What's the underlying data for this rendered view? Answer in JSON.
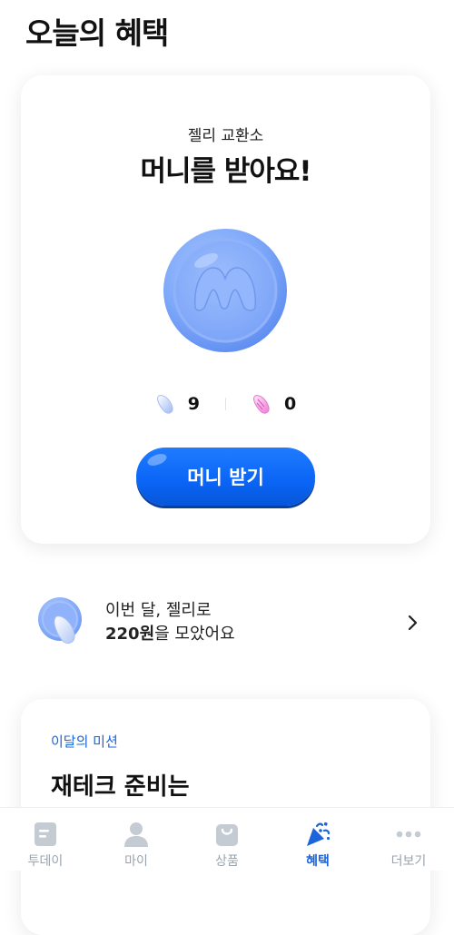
{
  "page": {
    "title": "오늘의 혜택"
  },
  "exchange_card": {
    "subtitle": "젤리 교환소",
    "title": "머니를 받아요!",
    "counts": [
      {
        "icon": "blue-jelly-icon",
        "value": "9"
      },
      {
        "icon": "pink-jelly-icon",
        "value": "0"
      }
    ],
    "button_label": "머니 받기"
  },
  "summary": {
    "line1": "이번 달, 젤리로",
    "amount": "220원",
    "line2_rest": "을 모았어요"
  },
  "mission": {
    "label": "이달의 미션",
    "title": "재테크 준비는"
  },
  "tabbar": {
    "items": [
      {
        "label": "투데이",
        "icon": "document-icon",
        "active": false
      },
      {
        "label": "마이",
        "icon": "person-icon",
        "active": false
      },
      {
        "label": "상품",
        "icon": "bag-icon",
        "active": false
      },
      {
        "label": "혜택",
        "icon": "party-popper-icon",
        "active": true
      },
      {
        "label": "더보기",
        "icon": "more-dots-icon",
        "active": false
      }
    ]
  },
  "colors": {
    "accent": "#1b64da",
    "button": "#0a64f5",
    "inactive_tab": "#c5cbd2",
    "coin": "#7ea8f9"
  }
}
